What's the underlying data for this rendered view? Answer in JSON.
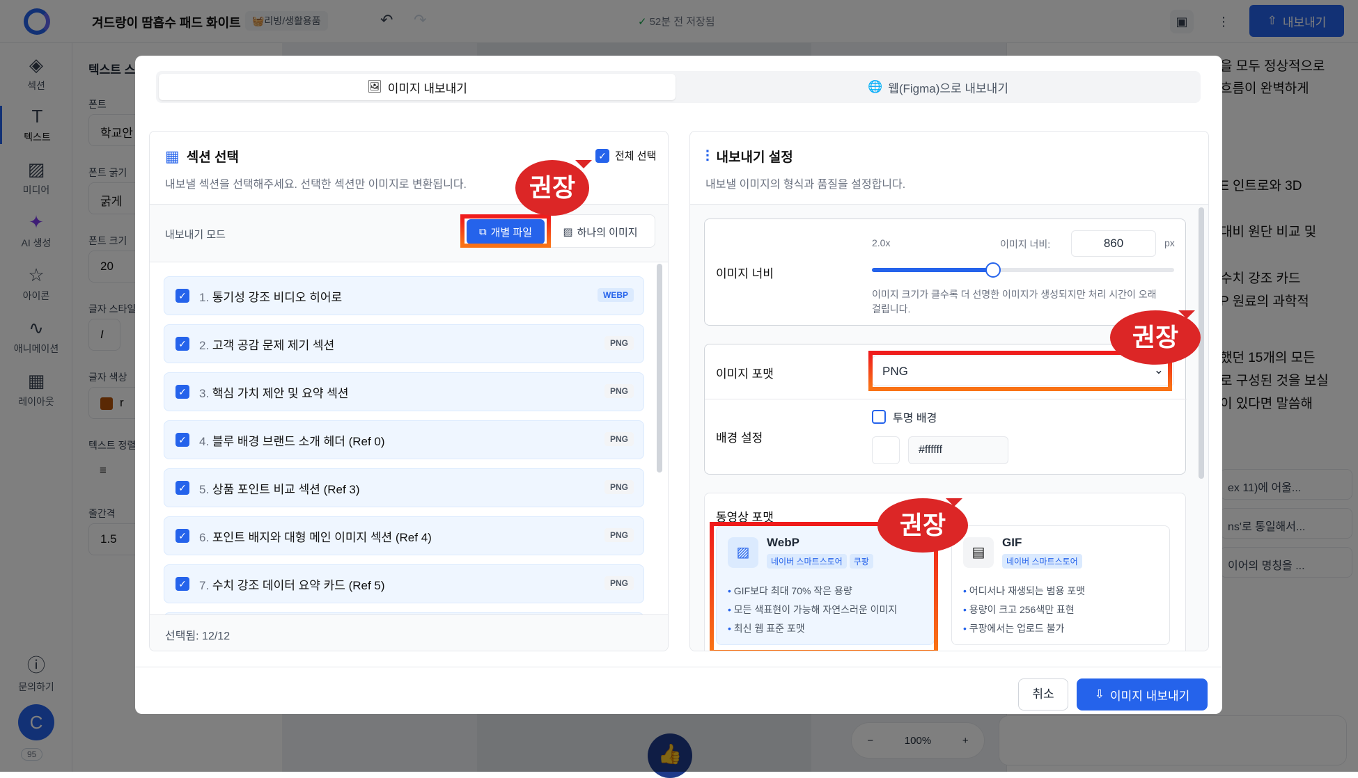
{
  "header": {
    "doc_title": "겨드랑이 땀흡수 패드 화이트",
    "category": "🧺리빙/생활용품",
    "saved_status": "52분 전 저장됨",
    "export_label": "내보내기"
  },
  "rail": {
    "items": [
      {
        "label": "섹션",
        "icon": "layers-icon"
      },
      {
        "label": "텍스트",
        "icon": "text-icon"
      },
      {
        "label": "미디어",
        "icon": "image-icon"
      },
      {
        "label": "AI 생성",
        "icon": "magic-wand-icon"
      },
      {
        "label": "아이콘",
        "icon": "star-icon"
      },
      {
        "label": "애니메이션",
        "icon": "curve-icon"
      },
      {
        "label": "레이아웃",
        "icon": "grid-icon"
      }
    ],
    "help_label": "문의하기",
    "avatar_initial": "C",
    "credits": "95"
  },
  "left_panel": {
    "title": "텍스트 스",
    "font_label": "폰트",
    "font_value": "학교안",
    "weight_label": "폰트 굵기",
    "weight_value": "굵게",
    "size_label": "폰트 크기",
    "size_value": "20",
    "style_label": "글자 스타일",
    "style_italic": "I",
    "color_label": "글자 색상",
    "color_value": "r",
    "align_label": "텍스트 정렬",
    "spacing_label": "줄간격",
    "spacing_value": "1.5"
  },
  "canvas": {
    "zoom": "100%"
  },
  "right_panel": {
    "lines": [
      "을 모두 정상적으로",
      "흐름이 완벽하게",
      "E 인트로와 3D",
      "대비 원단 비교 및",
      "수치 강조 카드",
      "P 원료의 과학적",
      "했던 15개의 모든",
      "로 구성된 것을 보실",
      "이 있다면 말씀해"
    ],
    "links": [
      "ex 11)에 어울...",
      "ns'로 통일해서...",
      "이어의 명칭을 ..."
    ]
  },
  "modal": {
    "tab_image": "이미지 내보내기",
    "tab_web": "웹(Figma)으로 내보내기",
    "section_select": {
      "title": "섹션 선택",
      "subtitle": "내보낼 섹션을 선택해주세요. 선택한 섹션만 이미지로 변환됩니다.",
      "select_all": "전체 선택",
      "mode_label": "내보내기 모드",
      "mode_individual": "개별 파일",
      "mode_single": "하나의 이미지",
      "recommend": "권장",
      "rows": [
        {
          "num": "1.",
          "name": "통기성 강조 비디오 히어로",
          "format": "WEBP"
        },
        {
          "num": "2.",
          "name": "고객 공감 문제 제기 섹션",
          "format": "PNG"
        },
        {
          "num": "3.",
          "name": "핵심 가치 제안 및 요약 섹션",
          "format": "PNG"
        },
        {
          "num": "4.",
          "name": "블루 배경 브랜드 소개 헤더 (Ref 0)",
          "format": "PNG"
        },
        {
          "num": "5.",
          "name": "상품 포인트 비교 섹션 (Ref 3)",
          "format": "PNG"
        },
        {
          "num": "6.",
          "name": "포인트 배지와 대형 메인 이미지 섹션 (Ref 4)",
          "format": "PNG"
        },
        {
          "num": "7.",
          "name": "수치 강조 데이터 요약 카드 (Ref 5)",
          "format": "PNG"
        }
      ],
      "selected_count": "선택됨: 12/12"
    },
    "settings": {
      "title": "내보내기 설정",
      "subtitle": "내보낼 이미지의 형식과 품질을 설정합니다.",
      "width_label": "이미지 너비",
      "scale": "2.0x",
      "width_input_label": "이미지 너비:",
      "width_value": "860",
      "unit": "px",
      "slider_fraction": 0.4,
      "width_help": "이미지 크기가 클수록 더 선명한 이미지가 생성되지만 처리 시간이 오래",
      "width_help2": "걸립니다.",
      "format_label": "이미지 포맷",
      "format_value": "PNG",
      "bg_label": "배경 설정",
      "transparent_label": "투명 배경",
      "bg_color": "#ffffff",
      "video_label": "동영상 포맷",
      "recommend": "권장",
      "webp": {
        "name": "WebP",
        "tags": [
          "네이버 스마트스토어",
          "쿠팡"
        ],
        "bullets": [
          "GIF보다 최대 70% 작은 용량",
          "모든 색표현이 가능해 자연스러운 이미지",
          "최신 웹 표준 포맷"
        ]
      },
      "gif": {
        "name": "GIF",
        "tags": [
          "네이버 스마트스토어"
        ],
        "bullets": [
          "어디서나 재생되는 범용 포맷",
          "용량이 크고 256색만 표현",
          "쿠팡에서는 업로드 불가"
        ]
      }
    },
    "cancel_label": "취소",
    "export_label": "이미지 내보내기"
  },
  "colors": {
    "accent": "#2563eb",
    "highlight": "#ef1c1c",
    "bubble": "#dc2626"
  }
}
